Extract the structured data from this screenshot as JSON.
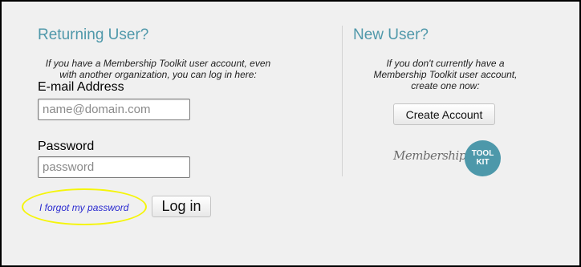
{
  "returning_user": {
    "title": "Returning User?",
    "intro": "If you have a Membership Toolkit user account, even\nwith another organization, you can log in here:",
    "email_label": "E-mail Address",
    "email_placeholder": "name@domain.com",
    "password_label": "Password",
    "password_placeholder": "password",
    "forgot_link": "I forgot my password",
    "login_button": "Log in"
  },
  "new_user": {
    "title": "New User?",
    "intro": "If you don't currently have a\nMembership Toolkit user account,\ncreate one now:",
    "create_button": "Create Account"
  },
  "logo": {
    "script_text": "Membership",
    "badge_text": "TOOL\nKIT"
  },
  "colors": {
    "title": "#4f98aa",
    "badge": "#4d98aa",
    "link": "#2a2ad0",
    "highlight": "#f5f50a",
    "panel_background": "#f0f0f0"
  }
}
